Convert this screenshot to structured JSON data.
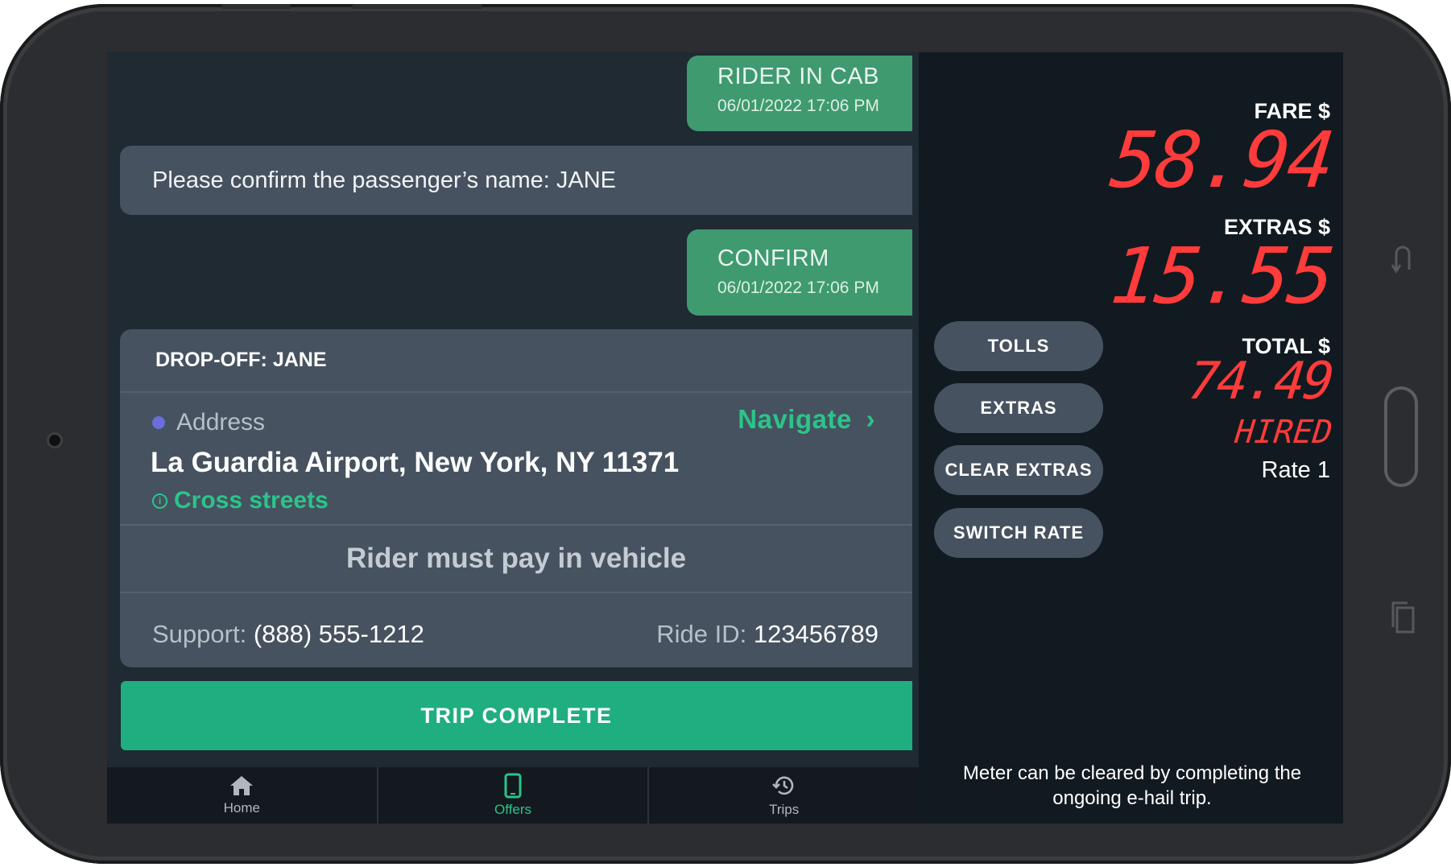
{
  "messages": [
    {
      "title": "RIDER IN CAB",
      "time": "06/01/2022 17:06 PM"
    },
    {
      "text": "Please confirm the passenger’s name: JANE"
    },
    {
      "title": "CONFIRM",
      "time": "06/01/2022 17:06 PM"
    }
  ],
  "dropoff": {
    "header": "DROP-OFF: JANE",
    "address_label": "Address",
    "navigate_label": "Navigate",
    "address": "La Guardia Airport, New York, NY 11371",
    "cross_streets": "Cross streets",
    "payment_note": "Rider must pay in vehicle",
    "support_label": "Support:",
    "support_phone": "(888) 555-1212",
    "ride_id_label": "Ride ID:",
    "ride_id": "123456789"
  },
  "trip_button": "TRIP COMPLETE",
  "nav": {
    "home": "Home",
    "offers": "Offers",
    "trips": "Trips"
  },
  "meter": {
    "fare_label": "FARE $",
    "fare": "58.94",
    "extras_label": "EXTRAS $",
    "extras": "15.55",
    "total_label": "TOTAL $",
    "total": "74.49",
    "status": "HIRED",
    "rate": "Rate 1",
    "buttons": {
      "tolls": "TOLLS",
      "extras": "EXTRAS",
      "clear_extras": "CLEAR EXTRAS",
      "switch_rate": "SWITCH RATE"
    },
    "note": "Meter can be cleared by completing the ongoing e-hail trip."
  },
  "colors": {
    "accent_green": "#1fae7f",
    "meter_red": "#ff3b3b",
    "bubble_green": "#3f9a70"
  }
}
